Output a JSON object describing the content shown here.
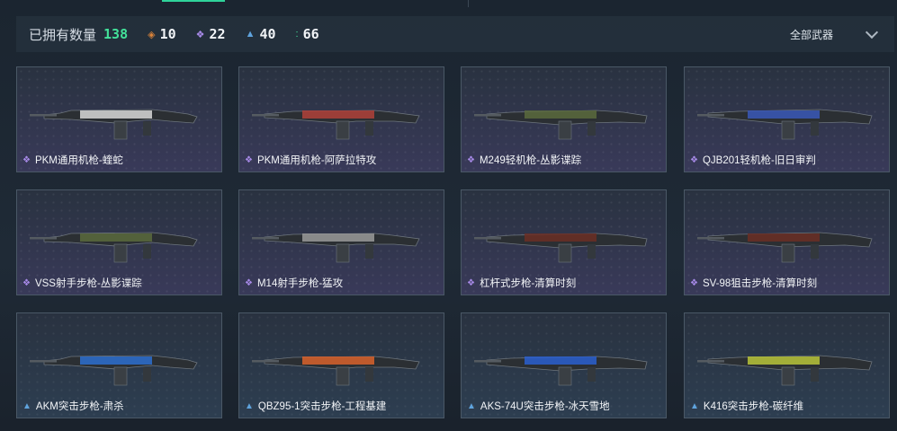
{
  "header": {
    "owned_label": "已拥有数量",
    "owned_count": "138",
    "stats": [
      {
        "icon": "orange-diamond-icon",
        "glyph": "◈",
        "color": "#d9833a",
        "value": "10"
      },
      {
        "icon": "purple-diamond-icon",
        "glyph": "❖",
        "color": "#a98bea",
        "value": "22"
      },
      {
        "icon": "blue-chevron-icon",
        "glyph": "▲",
        "color": "#5fa3dd",
        "value": "40"
      },
      {
        "icon": "green-dots-icon",
        "glyph": ":",
        "color": "#43e29a",
        "value": "66"
      }
    ],
    "filter_label": "全部武器"
  },
  "weapons": [
    {
      "name": "PKM通用机枪-蝰蛇",
      "rarity": "purple",
      "rarity_color": "#a98bea",
      "accent": "#d8d8d8"
    },
    {
      "name": "PKM通用机枪-阿萨拉特攻",
      "rarity": "purple",
      "rarity_color": "#a98bea",
      "accent": "#b0413a"
    },
    {
      "name": "M249轻机枪-丛影谍踪",
      "rarity": "purple",
      "rarity_color": "#a98bea",
      "accent": "#5b6a3d"
    },
    {
      "name": "QJB201轻机枪-旧日审判",
      "rarity": "purple",
      "rarity_color": "#a98bea",
      "accent": "#3a58b8"
    },
    {
      "name": "VSS射手步枪-丛影谍踪",
      "rarity": "purple",
      "rarity_color": "#a98bea",
      "accent": "#5b6a3d"
    },
    {
      "name": "M14射手步枪-猛攻",
      "rarity": "purple",
      "rarity_color": "#a98bea",
      "accent": "#9a9a9a"
    },
    {
      "name": "杠杆式步枪-清算时刻",
      "rarity": "purple",
      "rarity_color": "#a98bea",
      "accent": "#6b2e24"
    },
    {
      "name": "SV-98狙击步枪-清算时刻",
      "rarity": "purple",
      "rarity_color": "#a98bea",
      "accent": "#6b2e24"
    },
    {
      "name": "AKM突击步枪-肃杀",
      "rarity": "blue",
      "rarity_color": "#5fa3dd",
      "accent": "#2d6fd0"
    },
    {
      "name": "QBZ95-1突击步枪-工程基建",
      "rarity": "blue",
      "rarity_color": "#5fa3dd",
      "accent": "#d9622c"
    },
    {
      "name": "AKS-74U突击步枪-冰天雪地",
      "rarity": "blue",
      "rarity_color": "#5fa3dd",
      "accent": "#2a5fd0"
    },
    {
      "name": "K416突击步枪-碳纤维",
      "rarity": "blue",
      "rarity_color": "#5fa3dd",
      "accent": "#b8c43a"
    }
  ]
}
